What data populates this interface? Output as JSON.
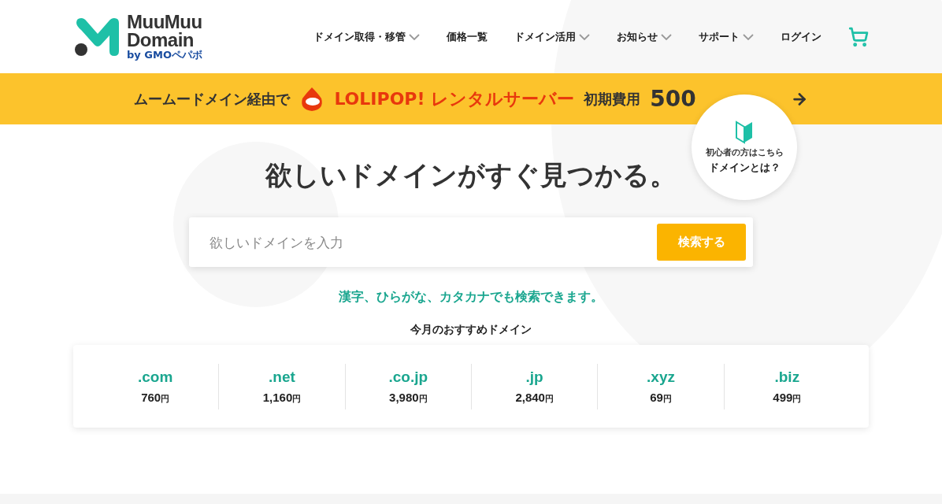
{
  "header": {
    "logo": {
      "line_1": "MuuMuu",
      "line_2": "Domain",
      "byline": "by GMOペパボ"
    },
    "nav": [
      {
        "label": "ドメイン取得・移管",
        "has_menu": true
      },
      {
        "label": "価格一覧",
        "has_menu": false
      },
      {
        "label": "ドメイン活用",
        "has_menu": true
      },
      {
        "label": "お知らせ",
        "has_menu": true
      },
      {
        "label": "サポート",
        "has_menu": true
      },
      {
        "label": "ログイン",
        "has_menu": false
      }
    ]
  },
  "banner": {
    "lead": "ムームードメイン経由で",
    "brand": "LOLIPOP! レンタルサーバー",
    "offer": "初期費用",
    "amount": "500"
  },
  "beginner_badge": {
    "line_1": "初心者の方はこちら",
    "line_2": "ドメインとは？"
  },
  "hero": {
    "title": "欲しいドメインがすぐ見つかる。",
    "search": {
      "placeholder": "欲しいドメインを入力",
      "button": "検索する"
    },
    "hint": "漢字、ひらがな、カタカナでも検索できます。"
  },
  "recommended": {
    "title": "今月のおすすめドメイン",
    "domains": [
      {
        "name": ".com",
        "price": "760",
        "unit": "円"
      },
      {
        "name": ".net",
        "price": "1,160",
        "unit": "円"
      },
      {
        "name": ".co.jp",
        "price": "3,980",
        "unit": "円"
      },
      {
        "name": ".jp",
        "price": "2,840",
        "unit": "円"
      },
      {
        "name": ".xyz",
        "price": "69",
        "unit": "円"
      },
      {
        "name": ".biz",
        "price": "499",
        "unit": "円"
      }
    ]
  }
}
